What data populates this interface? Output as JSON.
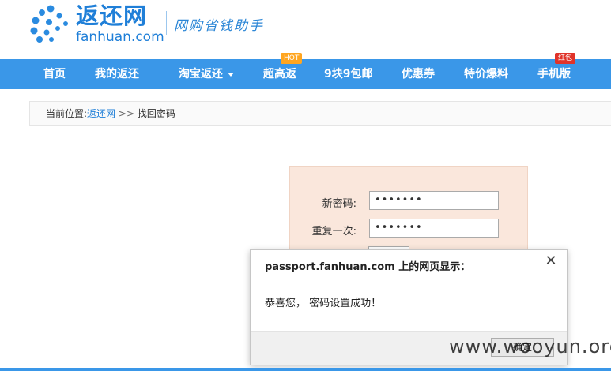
{
  "header": {
    "logo_cn": "返还网",
    "logo_en": "fanhuan.com",
    "slogan": "网购省钱助手"
  },
  "nav": {
    "items": [
      {
        "label": "首页"
      },
      {
        "label": "我的返还"
      },
      {
        "label": "淘宝返还"
      },
      {
        "label": "超高返"
      },
      {
        "label": "9块9包邮"
      },
      {
        "label": "优惠券"
      },
      {
        "label": "特价爆料"
      },
      {
        "label": "手机版"
      }
    ],
    "badge_hot": "HOT",
    "badge_red": "红包"
  },
  "breadcrumb": {
    "prefix": "当前位置:",
    "link": "返还网",
    "separator": ">>",
    "current": "找回密码"
  },
  "form": {
    "new_password_label": "新密码:",
    "new_password_value": "•••••••",
    "repeat_label": "重复一次:",
    "repeat_value": "•••••••"
  },
  "dialog": {
    "title": "passport.fanhuan.com 上的网页显示：",
    "message": "恭喜您， 密码设置成功！",
    "ok_label": "确定",
    "close_icon": "close-icon"
  },
  "watermark": "www.wooyun.org",
  "colors": {
    "brand_blue": "#3a97e8",
    "logo_blue": "#1f7fd8",
    "hot_orange": "#ffa51f",
    "red_badge": "#e0332a",
    "panel_bg": "#fae7dc"
  }
}
